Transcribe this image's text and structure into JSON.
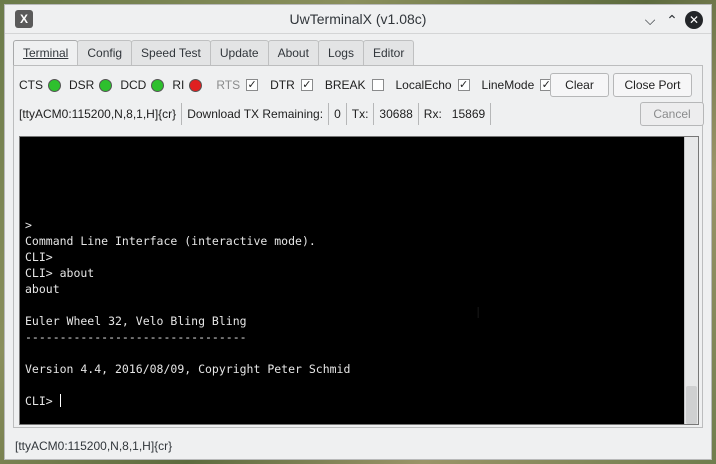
{
  "window": {
    "title": "UwTerminalX (v1.08c)",
    "app_icon": "X"
  },
  "window_buttons": {
    "minimize": "⌵",
    "maximize": "⌃",
    "close": "✕"
  },
  "tabs": [
    {
      "label": "Terminal",
      "active": true
    },
    {
      "label": "Config"
    },
    {
      "label": "Speed Test"
    },
    {
      "label": "Update"
    },
    {
      "label": "About"
    },
    {
      "label": "Logs"
    },
    {
      "label": "Editor"
    }
  ],
  "signals": {
    "cts": {
      "label": "CTS",
      "color": "#2ec02e"
    },
    "dsr": {
      "label": "DSR",
      "color": "#2ec02e"
    },
    "dcd": {
      "label": "DCD",
      "color": "#2ec02e"
    },
    "ri": {
      "label": "RI",
      "color": "#e02020"
    }
  },
  "checkboxes": {
    "rts": {
      "label": "RTS",
      "checked": "✓"
    },
    "dtr": {
      "label": "DTR",
      "checked": "✓"
    },
    "break": {
      "label": "BREAK",
      "checked": ""
    },
    "local_echo": {
      "label": "LocalEcho",
      "checked": "✓"
    },
    "line_mode": {
      "label": "LineMode",
      "checked": "✓"
    }
  },
  "buttons": {
    "clear": "Clear",
    "close_port": "Close Port",
    "cancel": "Cancel"
  },
  "info": {
    "port": "[ttyACM0:115200,N,8,1,H]{cr}",
    "download_label": "Download TX Remaining:",
    "download_value": "0",
    "tx_label": "Tx:",
    "tx_value": "30688",
    "rx_label": "Rx:",
    "rx_value": "15869"
  },
  "terminal": {
    "lines": [
      ">",
      "Command Line Interface (interactive mode).",
      "CLI>",
      "CLI> about",
      "about",
      "",
      "Euler Wheel 32, Velo Bling Bling",
      "--------------------------------",
      "",
      "Version 4.4, 2016/08/09, Copyright Peter Schmid",
      "",
      "CLI> "
    ]
  },
  "statusbar": "[ttyACM0:115200,N,8,1,H]{cr}",
  "pointer": "I"
}
